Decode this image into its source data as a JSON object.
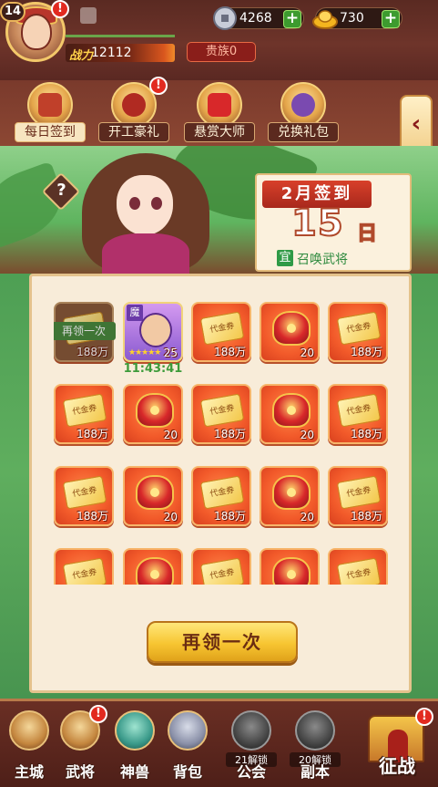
{
  "player": {
    "level": "14",
    "power_label": "战力",
    "power_value": "12112",
    "noble_label": "贵族0"
  },
  "currencies": [
    {
      "name": "silver",
      "icon": "silver-coin-icon",
      "value": "4268"
    },
    {
      "name": "gold",
      "icon": "gold-ingot-icon",
      "value": "730"
    }
  ],
  "badges": {
    "alert": "!"
  },
  "features": [
    {
      "label": "每日签到",
      "icon": "daily-signin-icon",
      "active": true
    },
    {
      "label": "开工豪礼",
      "icon": "work-gift-icon",
      "alert": true
    },
    {
      "label": "悬赏大师",
      "icon": "bounty-master-icon"
    },
    {
      "label": "兑换礼包",
      "icon": "exchange-gift-icon"
    }
  ],
  "side_arrow": "‹",
  "help_label": "?",
  "calendar": {
    "month_label": "2月签到",
    "day": "15",
    "day_suffix": "日",
    "yi_label": "宜",
    "activity": "召唤武将"
  },
  "rewards": {
    "claimed_banner": "再领一次",
    "hero_tag": "魔",
    "hero_level": "25",
    "hero_stars": "★★★★★",
    "timer": "11:43:41",
    "ticket_text": "代金券",
    "items": [
      {
        "type": "ticket",
        "qty": "188万",
        "state": "claimed"
      },
      {
        "type": "hero",
        "qty": "25"
      },
      {
        "type": "ticket",
        "qty": "188万"
      },
      {
        "type": "helmet",
        "qty": "20"
      },
      {
        "type": "ticket",
        "qty": "188万"
      },
      {
        "type": "ticket",
        "qty": "188万"
      },
      {
        "type": "helmet",
        "qty": "20"
      },
      {
        "type": "ticket",
        "qty": "188万"
      },
      {
        "type": "helmet",
        "qty": "20"
      },
      {
        "type": "ticket",
        "qty": "188万"
      },
      {
        "type": "ticket",
        "qty": "188万"
      },
      {
        "type": "helmet",
        "qty": "20"
      },
      {
        "type": "ticket",
        "qty": "188万"
      },
      {
        "type": "helmet",
        "qty": "20"
      },
      {
        "type": "ticket",
        "qty": "188万"
      },
      {
        "type": "ticket",
        "qty": ""
      },
      {
        "type": "helmet",
        "qty": ""
      },
      {
        "type": "ticket",
        "qty": ""
      },
      {
        "type": "helmet",
        "qty": ""
      },
      {
        "type": "ticket",
        "qty": ""
      }
    ]
  },
  "again_button": "再领一次",
  "bottom_nav": [
    {
      "label": "主城",
      "icon": "main-city-icon"
    },
    {
      "label": "武将",
      "icon": "general-icon",
      "alert": true
    },
    {
      "label": "神兽",
      "icon": "divine-beast-icon"
    },
    {
      "label": "背包",
      "icon": "backpack-icon"
    },
    {
      "label": "公会",
      "icon": "guild-icon",
      "locked": true,
      "lock_note": "21解锁"
    },
    {
      "label": "副本",
      "icon": "dungeon-icon",
      "locked": true,
      "lock_note": "20解锁"
    }
  ],
  "campaign": {
    "label": "征战",
    "icon": "campaign-gate-icon",
    "alert": true
  }
}
